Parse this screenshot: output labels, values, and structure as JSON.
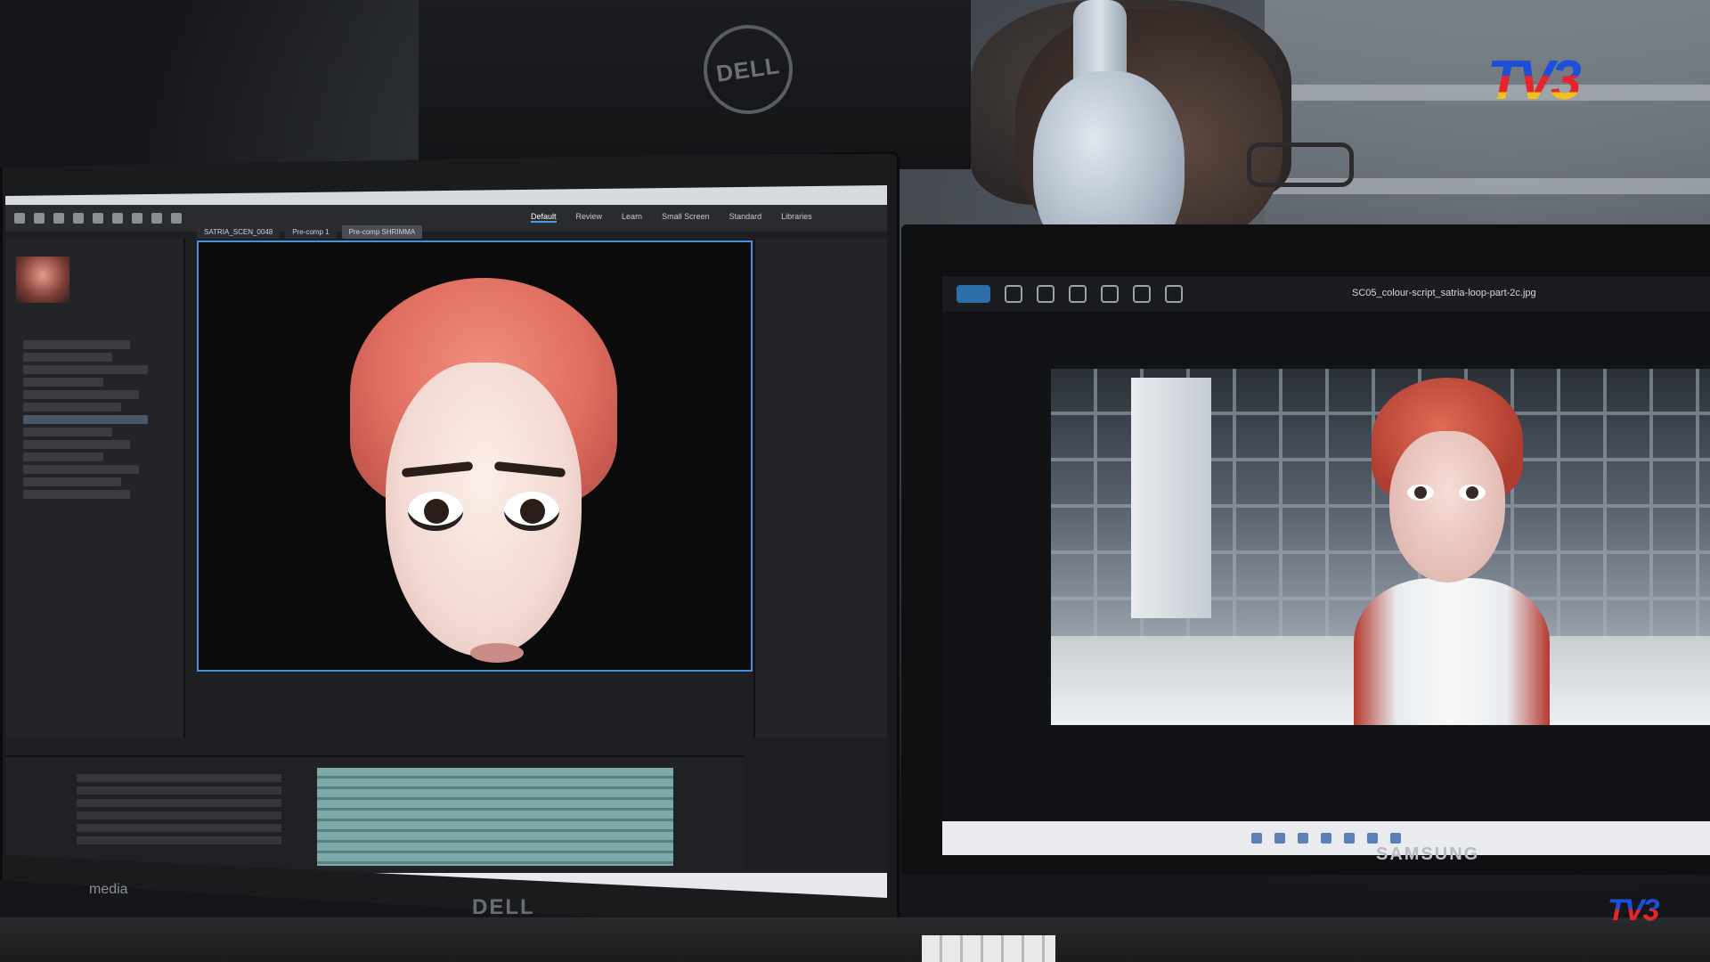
{
  "scene": {
    "description_tag": "photo",
    "left_monitor_brand": "DELL",
    "back_monitor_brand": "DELL",
    "right_monitor_brand": "SAMSUNG",
    "broadcaster_logo": "TV3",
    "corner_watermark": "media"
  },
  "left_screen": {
    "workspace_tabs": [
      "Default",
      "Review",
      "Learn",
      "Small Screen",
      "Standard",
      "Libraries"
    ],
    "composition_tabs": [
      "SATRIA_SCEN_0048",
      "Pre-comp 1",
      "Pre-comp SHRIMMA"
    ]
  },
  "right_screen": {
    "filename": "SC05_colour-script_satria-loop-part-2c.jpg"
  },
  "colors": {
    "tv3_blue": "#1d4fd8",
    "tv3_red": "#e8242b",
    "tv3_yellow": "#f3c21a",
    "ae_selection": "#4a8ee0",
    "hijab_coral": "#e07060"
  }
}
